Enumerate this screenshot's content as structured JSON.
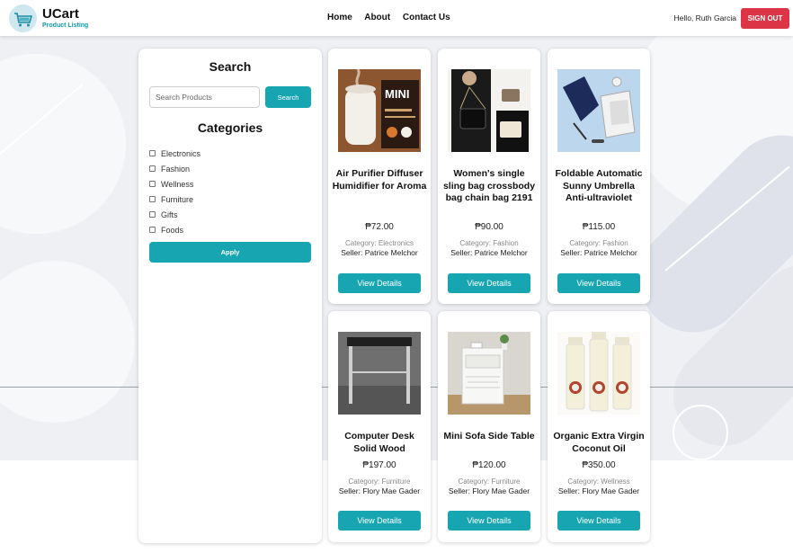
{
  "header": {
    "brand": "UCart",
    "brand_sub": "Product Listing",
    "nav": [
      "Home",
      "About",
      "Contact Us"
    ],
    "greeting": "Hello, Ruth Garcia",
    "signout_label": "SIGN OUT"
  },
  "sidebar": {
    "search_title": "Search",
    "search_placeholder": "Search Products",
    "search_button": "Search",
    "categories_title": "Categories",
    "categories": [
      "Electronics",
      "Fashion",
      "Wellness",
      "Furniture",
      "Gifts",
      "Foods"
    ],
    "apply_button": "Apply"
  },
  "products": [
    {
      "name": "Air Purifier Diffuser Humidifier for Aroma",
      "price": "₱72.00",
      "category": "Category: Electronics",
      "seller": "Seller: Patrice Melchor",
      "button": "View Details",
      "image": "humidifier-image"
    },
    {
      "name": "Women's single sling bag crossbody bag chain bag 2191",
      "price": "₱90.00",
      "category": "Category: Fashion",
      "seller": "Seller: Patrice Melchor",
      "button": "View Details",
      "image": "handbag-image"
    },
    {
      "name": "Foldable Automatic Sunny Umbrella Anti-ultraviolet",
      "price": "₱115.00",
      "category": "Category: Fashion",
      "seller": "Seller: Patrice Melchor",
      "button": "View Details",
      "image": "umbrella-image"
    },
    {
      "name": "Computer Desk Solid Wood",
      "price": "₱197.00",
      "category": "Category: Furniture",
      "seller": "Seller: Flory Mae Gader",
      "button": "View Details",
      "image": "desk-image"
    },
    {
      "name": "Mini Sofa Side Table",
      "price": "₱120.00",
      "category": "Category: Furniture",
      "seller": "Seller: Flory Mae Gader",
      "button": "View Details",
      "image": "side-table-image"
    },
    {
      "name": "Organic Extra Virgin Coconut Oil",
      "price": "₱350.00",
      "category": "Category: Wellness",
      "seller": "Seller: Flory Mae Gader",
      "button": "View Details",
      "image": "coconut-oil-image"
    }
  ],
  "colors": {
    "accent": "#17a6b1",
    "signout": "#dc3545",
    "brand_sub": "#129aa7"
  }
}
